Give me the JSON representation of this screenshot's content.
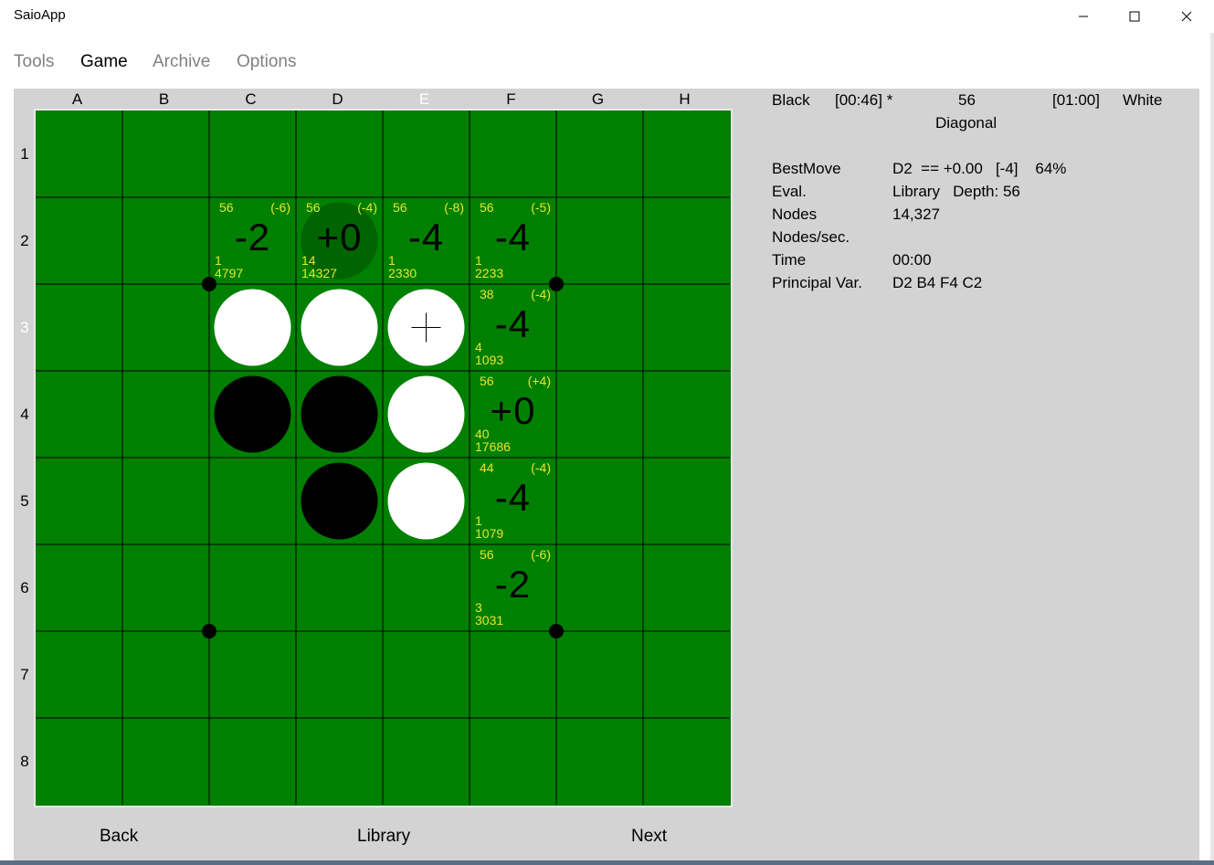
{
  "window": {
    "title": "SaioApp",
    "minimize_glyph": "—",
    "maximize_glyph": "☐",
    "close_glyph": "✕"
  },
  "menu": {
    "tools": "Tools",
    "game": "Game",
    "archive": "Archive",
    "options": "Options"
  },
  "board": {
    "columns": [
      "A",
      "B",
      "C",
      "D",
      "E",
      "F",
      "G",
      "H"
    ],
    "rows": [
      "1",
      "2",
      "3",
      "4",
      "5",
      "6",
      "7",
      "8"
    ],
    "highlighted_column": "E",
    "highlighted_row": "3",
    "colors": {
      "board": "#008000",
      "lines": "#000000",
      "hint_text": "#e6e62e",
      "best_move_highlight": "#006400"
    },
    "discs": [
      {
        "cell": "C3",
        "color": "white"
      },
      {
        "cell": "D3",
        "color": "white"
      },
      {
        "cell": "E3",
        "color": "white",
        "crosshair": true
      },
      {
        "cell": "C4",
        "color": "black"
      },
      {
        "cell": "D4",
        "color": "black"
      },
      {
        "cell": "E4",
        "color": "white"
      },
      {
        "cell": "D5",
        "color": "black"
      },
      {
        "cell": "E5",
        "color": "white"
      }
    ],
    "hints": [
      {
        "cell": "C2",
        "depth": "56",
        "delta": "(-6)",
        "score": "-2",
        "count": "1",
        "nodes": "4797"
      },
      {
        "cell": "D2",
        "depth": "56",
        "delta": "(-4)",
        "score": "+0",
        "count": "14",
        "nodes": "14327",
        "best": true
      },
      {
        "cell": "E2",
        "depth": "56",
        "delta": "(-8)",
        "score": "-4",
        "count": "1",
        "nodes": "2330"
      },
      {
        "cell": "F2",
        "depth": "56",
        "delta": "(-5)",
        "score": "-4",
        "count": "1",
        "nodes": "2233"
      },
      {
        "cell": "F3",
        "depth": "38",
        "delta": "(-4)",
        "score": "-4",
        "count": "4",
        "nodes": "1093"
      },
      {
        "cell": "F4",
        "depth": "56",
        "delta": "(+4)",
        "score": "+0",
        "count": "40",
        "nodes": "17686"
      },
      {
        "cell": "F5",
        "depth": "44",
        "delta": "(-4)",
        "score": "-4",
        "count": "1",
        "nodes": "1079"
      },
      {
        "cell": "F6",
        "depth": "56",
        "delta": "(-6)",
        "score": "-2",
        "count": "3",
        "nodes": "3031"
      }
    ]
  },
  "status": {
    "black_label": "Black",
    "black_time": "[00:46] *",
    "depth": "56",
    "white_time": "[01:00]",
    "white_label": "White",
    "opening": "Diagonal"
  },
  "analysis": {
    "bestmove_label": "BestMove",
    "bestmove_value": "D2  == +0.00   [-4]    64%",
    "eval_label": "Eval.",
    "eval_value": "Library   Depth: 56",
    "nodes_label": "Nodes",
    "nodes_value": "14,327",
    "nps_label": "Nodes/sec.",
    "nps_value": "",
    "time_label": "Time",
    "time_value": "00:00",
    "pv_label": "Principal Var.",
    "pv_value": "D2 B4 F4 C2"
  },
  "buttons": {
    "back": "Back",
    "library": "Library",
    "next": "Next"
  }
}
